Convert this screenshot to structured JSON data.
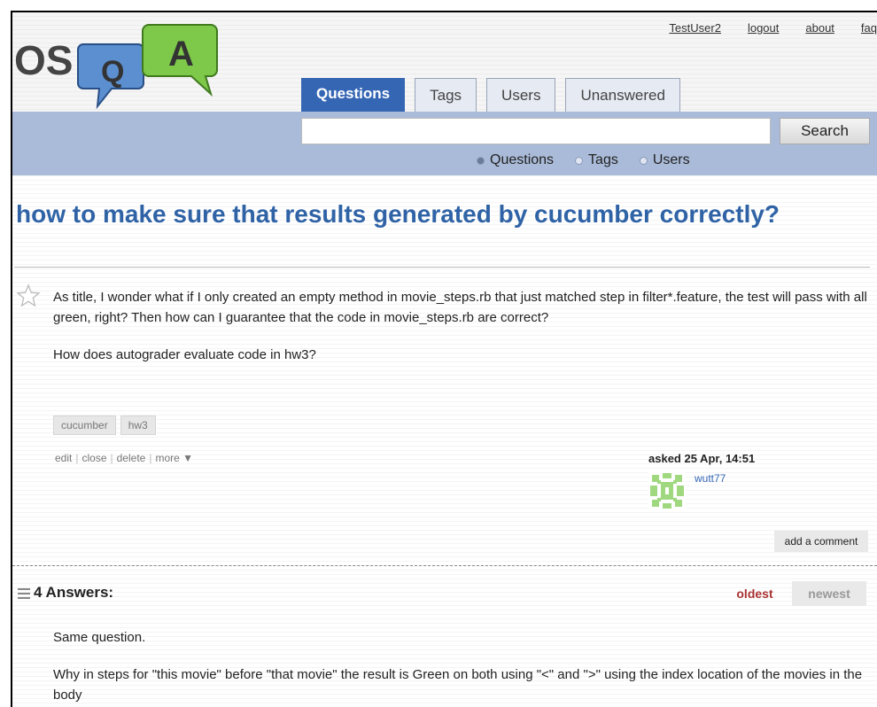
{
  "top_links": [
    "TestUser2",
    "logout",
    "about",
    "faq"
  ],
  "logo": {
    "text_os": "OS",
    "text_q": "Q",
    "text_a": "A"
  },
  "tabs": [
    {
      "label": "Questions",
      "active": true
    },
    {
      "label": "Tags",
      "active": false
    },
    {
      "label": "Users",
      "active": false
    },
    {
      "label": "Unanswered",
      "active": false
    }
  ],
  "search": {
    "value": "",
    "button_label": "Search"
  },
  "search_scope": [
    {
      "label": "Questions",
      "selected": true
    },
    {
      "label": "Tags",
      "selected": false
    },
    {
      "label": "Users",
      "selected": false
    }
  ],
  "question": {
    "title": "how to make sure that results generated by cucumber correctly?",
    "body": [
      "As title, I wonder what if I only created an empty method in movie_steps.rb that just matched step in filter*.feature, the test will pass with all green, right? Then how can I guarantee that the code in movie_steps.rb are correct?",
      "How does autograder evaluate code in hw3?"
    ],
    "tags": [
      "cucumber",
      "hw3"
    ],
    "actions": [
      "edit",
      "close",
      "delete",
      "more ▼"
    ],
    "asked_label": "asked 25 Apr, 14:51",
    "author": "wutt77",
    "add_comment": "add a comment"
  },
  "answers": {
    "count_label": "4 Answers:",
    "sort_oldest": "oldest",
    "sort_newest": "newest",
    "first_answer": [
      "Same question.",
      "Why in steps for \"this movie\" before \"that movie\" the result is Green on both using \"<\" and \">\" using the index location of the movies in the body"
    ]
  },
  "colors": {
    "accent": "#2f63a6",
    "tab_active": "#3566b4",
    "search_band": "#aabbd9",
    "logo_blue": "#5b8fd0",
    "logo_green": "#7ec84a"
  }
}
